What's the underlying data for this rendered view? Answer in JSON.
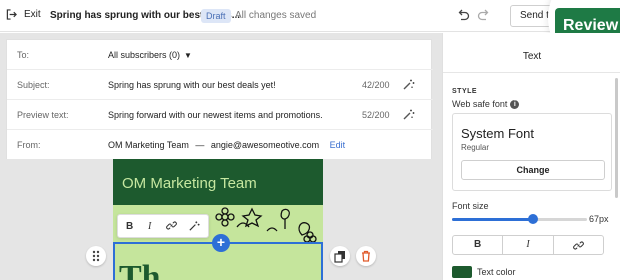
{
  "topbar": {
    "exit_label": "Exit",
    "campaign_title": "Spring has sprung with our best deals...",
    "status_badge": "Draft",
    "save_status": "All changes saved",
    "send_label": "Send t",
    "review_label": "Review"
  },
  "fields": {
    "to": {
      "label": "To:",
      "value": "All subscribers (0)"
    },
    "subject": {
      "label": "Subject:",
      "value": "Spring has sprung with our best deals yet!",
      "count": "42/200"
    },
    "preview": {
      "label": "Preview text:",
      "value": "Spring forward with our newest items and promotions.",
      "count": "52/200"
    },
    "from": {
      "label": "From:",
      "name": "OM Marketing Team",
      "separator": "—",
      "email": "angie@awesomeotive.com",
      "edit_label": "Edit"
    }
  },
  "email": {
    "header_text": "OM Marketing Team",
    "big_text": "Th",
    "toolbar": {
      "bold": "B",
      "italic": "I"
    }
  },
  "panel": {
    "title": "Text",
    "style_heading": "STYLE",
    "font_label": "Web safe font",
    "font_name": "System Font",
    "font_weight": "Regular",
    "change_label": "Change",
    "font_size_label": "Font size",
    "font_size_value": "67px",
    "font_size_fraction": 0.6,
    "bold_label": "B",
    "italic_label": "I",
    "text_color_label": "Text color"
  },
  "colors": {
    "brand_green": "#1d5a2e",
    "review_green": "#1e7a45",
    "email_bg": "#c5e59c",
    "accent_blue": "#2d6fd6"
  }
}
